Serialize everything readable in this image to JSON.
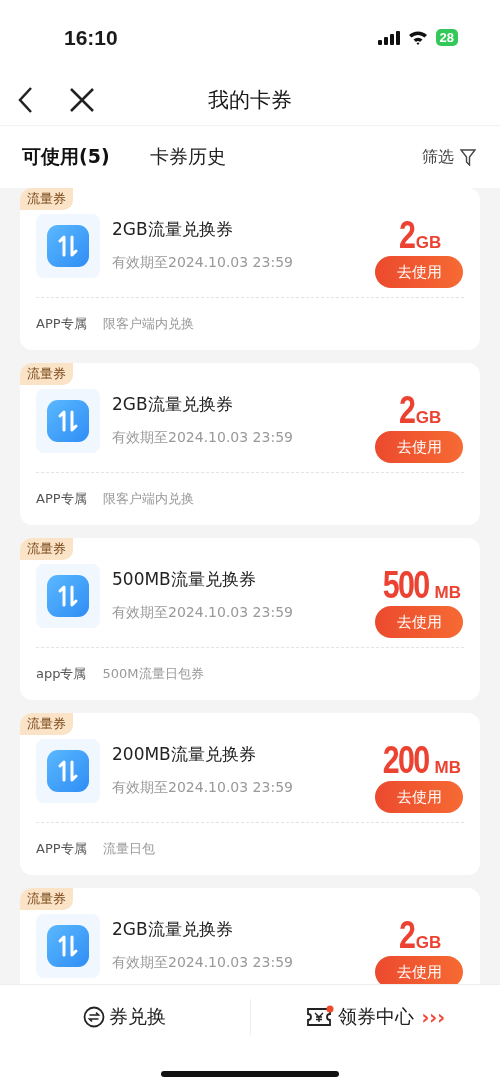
{
  "status_bar": {
    "time": "16:10",
    "battery": "28"
  },
  "nav": {
    "title": "我的卡券"
  },
  "tabs": [
    {
      "label": "可使用(5)",
      "selected": true
    },
    {
      "label": "卡券历史",
      "selected": false
    }
  ],
  "filter": {
    "label": "筛选"
  },
  "coupons": [
    {
      "tag": "流量券",
      "title": "2GB流量兑换券",
      "validity": "有效期至2024.10.03 23:59",
      "amount": "2",
      "unit": "GB",
      "button": "去使用",
      "platform": "APP专属",
      "note": "限客户端内兑换"
    },
    {
      "tag": "流量券",
      "title": "2GB流量兑换券",
      "validity": "有效期至2024.10.03 23:59",
      "amount": "2",
      "unit": "GB",
      "button": "去使用",
      "platform": "APP专属",
      "note": "限客户端内兑换"
    },
    {
      "tag": "流量券",
      "title": "500MB流量兑换券",
      "validity": "有效期至2024.10.03 23:59",
      "amount": "500",
      "unit": "MB",
      "button": "去使用",
      "platform": "app专属",
      "note": "500M流量日包券"
    },
    {
      "tag": "流量券",
      "title": "200MB流量兑换券",
      "validity": "有效期至2024.10.03 23:59",
      "amount": "200",
      "unit": "MB",
      "button": "去使用",
      "platform": "APP专属",
      "note": "流量日包"
    },
    {
      "tag": "流量券",
      "title": "2GB流量兑换券",
      "validity": "有效期至2024.10.03 23:59",
      "amount": "2",
      "unit": "GB",
      "button": "去使用"
    }
  ],
  "bottom_bar": {
    "exchange": "券兑换",
    "center": "领券中心",
    "center_arrows": "›››"
  }
}
